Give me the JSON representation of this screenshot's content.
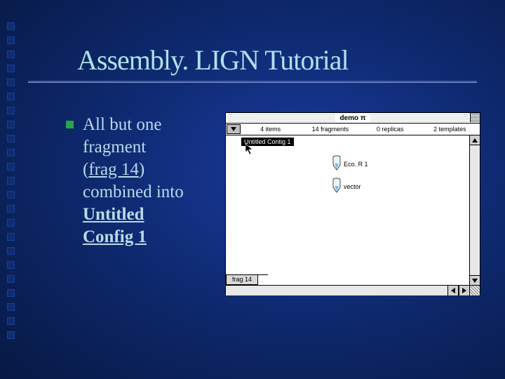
{
  "slide": {
    "title": "Assembly. LIGN Tutorial",
    "bullet": {
      "line1": "All but one",
      "line2": "fragment",
      "open_paren": "(",
      "frag14": "frag 14",
      "close_paren": ")",
      "line4": "combined into",
      "cfg1": "Untitled",
      "cfg2": "Config 1"
    }
  },
  "app": {
    "title": "demo π",
    "counts": {
      "items": "4  items",
      "fragments": "14 fragments",
      "replicas": "0 replicas",
      "templates": "2 templates"
    },
    "contig_label": "Untitled Contig 1",
    "tubes": {
      "eco": "Eco. R 1",
      "vector": "vector"
    },
    "frag_tab": "frag 14"
  }
}
